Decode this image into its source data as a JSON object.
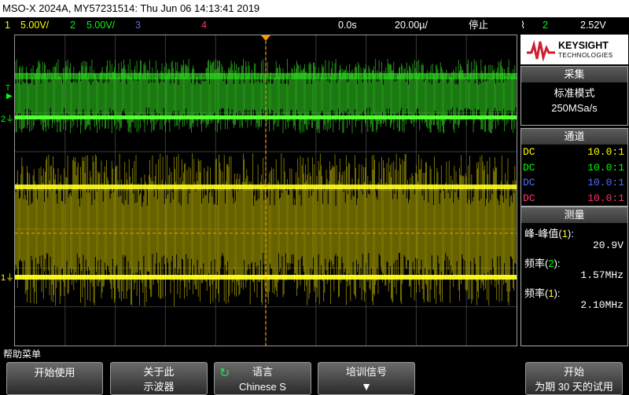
{
  "title": "MSO-X 2024A, MY57231514: Thu Jun 06 14:13:41 2019",
  "status": {
    "ch1_num": "1",
    "ch1_scale": "5.00V/",
    "ch2_num": "2",
    "ch2_scale": "5.00V/",
    "ch3_num": "3",
    "ch4_num": "4",
    "delay": "0.0s",
    "timebase": "20.00µ/",
    "run_state": "停止",
    "trig_slope_icon": "rising-edge-icon",
    "trig_source": "2",
    "trig_level": "2.52V"
  },
  "logo": {
    "name": "KEYSIGHT",
    "sub": "TECHNOLOGIES"
  },
  "acquire": {
    "header": "采集",
    "mode": "标准模式",
    "rate": "250MSa/s"
  },
  "channels": {
    "header": "通道",
    "rows": [
      {
        "coupling": "DC",
        "probe": "10.0:1",
        "color": "#ffff00"
      },
      {
        "coupling": "DC",
        "probe": "10.0:1",
        "color": "#00ff00"
      },
      {
        "coupling": "DC",
        "probe": "10.0:1",
        "color": "#4f6bff"
      },
      {
        "coupling": "DC",
        "probe": "10.0:1",
        "color": "#ff3366"
      }
    ]
  },
  "measure": {
    "header": "测量",
    "items": [
      {
        "label": "峰-峰值",
        "ch": "1",
        "value": "20.9V"
      },
      {
        "label": "频率",
        "ch": "2",
        "value": "1.57MHz"
      },
      {
        "label": "频率",
        "ch": "1",
        "value": "2.10MHz"
      }
    ]
  },
  "help_menu": "帮助菜单",
  "softkeys": [
    {
      "line1": "开始使用",
      "line2": ""
    },
    {
      "line1": "关于此",
      "line2": "示波器"
    },
    {
      "line1": "语言",
      "line2": "Chinese S"
    },
    {
      "line1": "培训信号",
      "line2": ""
    },
    {
      "line1": "开始",
      "line2": "为期 30 天的试用"
    }
  ],
  "markers": {
    "ch1": "1",
    "ch2": "2",
    "trig": "T"
  },
  "colors": {
    "ch1": "#ffff00",
    "ch2": "#00ff00",
    "ch3": "#4f6bff",
    "ch4": "#ff3366",
    "trigger": "#ff9900",
    "accent": "#cc1f2f"
  }
}
